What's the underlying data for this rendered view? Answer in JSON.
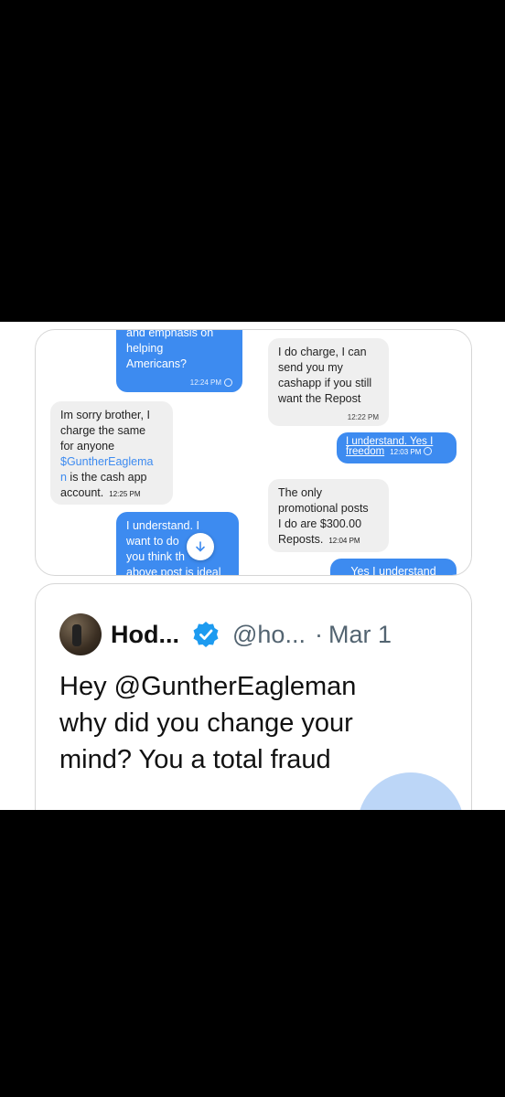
{
  "messages": {
    "m1": {
      "lines": [
        "and emphasis on",
        "helping",
        "Americans?"
      ],
      "time": "12:24 PM"
    },
    "m2": {
      "lines": [
        "I do charge, I can",
        "send you my",
        "cashapp if you still",
        "want the Repost"
      ],
      "time": "12:22 PM"
    },
    "m3": {
      "line1": "Im sorry brother, I",
      "line2": "charge the same",
      "line3": "for anyone",
      "link1": "$GuntherEaglema",
      "link2": "n",
      "rest": " is the cash app",
      "line5": "account.",
      "time": "12:25 PM"
    },
    "m4": {
      "line1": "I understand. Yes I",
      "line2": "freedom",
      "time": "12:03 PM"
    },
    "m5": {
      "lines": [
        "The only",
        "promotional posts",
        "I do are $300.00"
      ],
      "last": "Reposts.",
      "time": "12:04 PM"
    },
    "m6": {
      "lines": [
        "I understand. I",
        "want to do",
        "you think th",
        "above post is ideal"
      ]
    },
    "m7": {
      "text": "Yes I understand"
    }
  },
  "tweet": {
    "name": "Hod...",
    "handle": "@ho...",
    "separator": "·",
    "date": "Mar 1",
    "text_lines": [
      "Hey @GuntherEagleman",
      "why did you change your",
      "mind? You a total fraud"
    ]
  },
  "icons": {
    "verified": "verified-badge-icon",
    "scroll_down": "arrow-down-icon"
  },
  "colors": {
    "bubble_blue": "#3d8bf0",
    "bubble_gray": "#efefef",
    "verified_blue": "#1d9bf0"
  }
}
